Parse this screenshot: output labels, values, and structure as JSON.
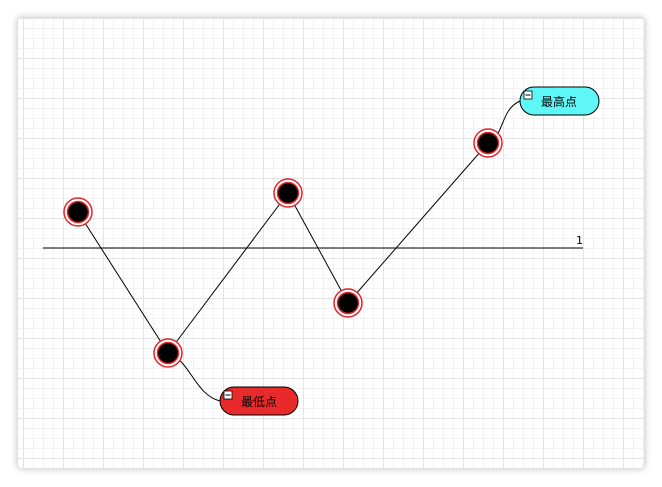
{
  "diagram": {
    "threshold_label": "1",
    "series": [
      {
        "point": "p1",
        "level": "mid"
      },
      {
        "point": "p2",
        "level": "low"
      },
      {
        "point": "p3",
        "level": "mid"
      },
      {
        "point": "p4",
        "level": "low-mid"
      },
      {
        "point": "p5",
        "level": "high"
      }
    ],
    "callouts": {
      "highest": {
        "label": "最高点",
        "fill": "#5ef7f7",
        "toggle": "−"
      },
      "lowest": {
        "label": "最低点",
        "fill": "#e82a2a",
        "toggle": "−"
      }
    },
    "colors": {
      "node_fill": "#000000",
      "node_ring": "#e0242a",
      "line": "#000000"
    }
  }
}
